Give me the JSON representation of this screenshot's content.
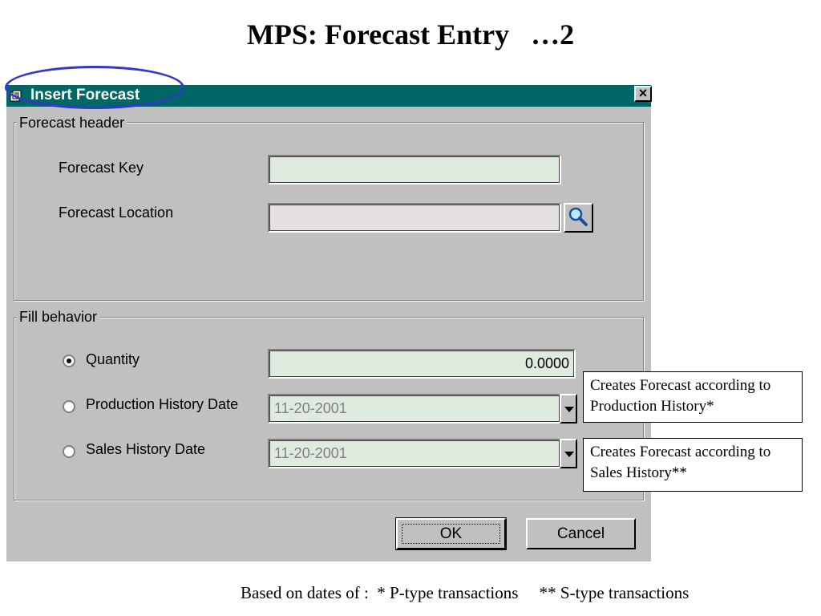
{
  "slide": {
    "title": "MPS: Forecast Entry   …2",
    "footer": "Based on dates of :  * P-type transactions     ** S-type transactions"
  },
  "dialog": {
    "title": "Insert Forecast",
    "close_label": "×",
    "header_group": {
      "legend": "Forecast header",
      "key_label": "Forecast Key",
      "key_value": "",
      "location_label": "Forecast Location",
      "location_value": "",
      "lookup_icon": "magnifier-icon"
    },
    "fill_group": {
      "legend": "Fill behavior",
      "options": [
        {
          "label": "Quantity",
          "selected": true,
          "value": "0.0000"
        },
        {
          "label": "Production History Date",
          "selected": false,
          "value": "11-20-2001"
        },
        {
          "label": "Sales History Date",
          "selected": false,
          "value": "11-20-2001"
        }
      ]
    },
    "buttons": {
      "ok": "OK",
      "cancel": "Cancel"
    }
  },
  "callouts": {
    "production": "Creates Forecast according to Production History*",
    "sales": "Creates Forecast according to Sales History**"
  },
  "colors": {
    "titlebar": "#006666",
    "dialog_bg": "#c0c0c0",
    "input_green": "#e0ebe0",
    "input_pink": "#e4e0e4",
    "highlight_oval": "#3636c8"
  }
}
